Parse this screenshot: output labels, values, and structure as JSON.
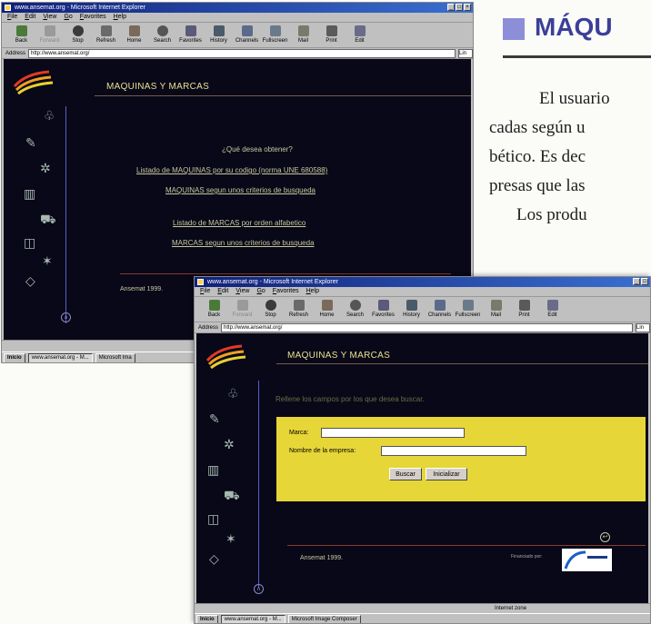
{
  "doc": {
    "heading": "MÁQU",
    "lines": [
      "El usuario",
      "cadas según u",
      "bético. Es dec",
      "presas que las",
      "Los produ"
    ]
  },
  "window1": {
    "title": "www.ansemat.org - Microsoft Internet Explorer",
    "menu": [
      "File",
      "Edit",
      "View",
      "Go",
      "Favorites",
      "Help"
    ],
    "toolbar": [
      "Back",
      "Forward",
      "Stop",
      "Refresh",
      "Home",
      "Search",
      "Favorites",
      "History",
      "Channels",
      "Fullscreen",
      "Mail",
      "Print",
      "Edit"
    ],
    "address_label": "Address",
    "address": "http://www.ansemat.org/",
    "links_label": "Lin",
    "page": {
      "title": "MAQUINAS Y MARCAS",
      "question": "¿Qué desea obtener?",
      "links": [
        "Listado de MAQUINAS por su codigo (norma UNE 680588)",
        "MAQUINAS segun unos criterios de busqueda",
        "Listado de MARCAS por orden alfabetico",
        "MARCAS segun unos criterios de busqueda"
      ],
      "footer": "Ansemat 1999."
    },
    "taskbar": [
      "Inicio",
      "www.ansemat.org - M...",
      "Microsoft Ima"
    ]
  },
  "window2": {
    "title": "www.ansemat.org - Microsoft Internet Explorer",
    "menu": [
      "File",
      "Edit",
      "View",
      "Go",
      "Favorites",
      "Help"
    ],
    "toolbar": [
      "Back",
      "Forward",
      "Stop",
      "Refresh",
      "Home",
      "Search",
      "Favorites",
      "History",
      "Channels",
      "Fullscreen",
      "Mail",
      "Print",
      "Edit"
    ],
    "address_label": "Address",
    "address": "http://www.ansemat.org/",
    "links_label": "Lin",
    "page": {
      "title": "MAQUINAS Y MARCAS",
      "subtitle": "Rellene los campos por los que desea buscar.",
      "marca_label": "Marca:",
      "marca_value": "",
      "empresa_label": "Nombre de la empresa:",
      "empresa_value": "",
      "buscar": "Buscar",
      "inicializar": "Inicializar",
      "footer": "Ansemat 1999.",
      "financiado": "Financiado por:"
    },
    "status": "Internet zone",
    "taskbar": [
      "Inicio",
      "www.ansemat.org - M...",
      "Microsoft Image Composer"
    ]
  }
}
